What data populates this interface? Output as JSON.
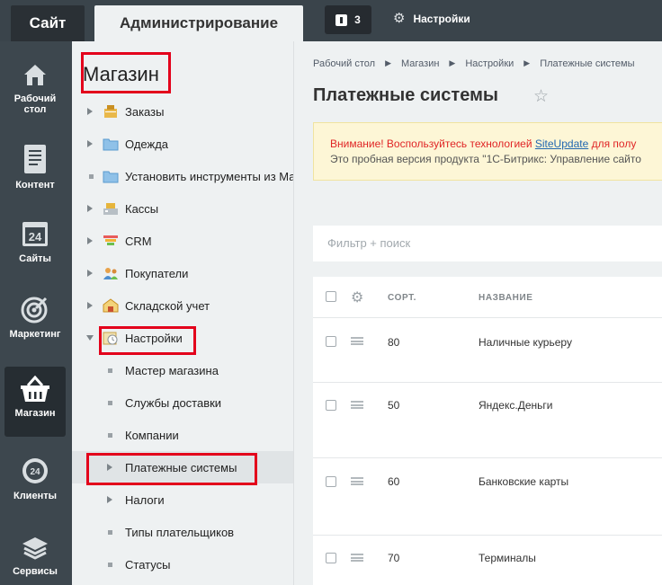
{
  "topbar": {
    "tab_site": "Сайт",
    "tab_admin": "Администрирование",
    "notifications_count": "3",
    "settings_label": "Настройки"
  },
  "rail": [
    {
      "label": "Рабочий стол",
      "icon": "home-icon"
    },
    {
      "label": "Контент",
      "icon": "document-icon"
    },
    {
      "label": "Сайты",
      "icon": "calendar-24-icon"
    },
    {
      "label": "Маркетинг",
      "icon": "target-icon"
    },
    {
      "label": "Магазин",
      "icon": "basket-icon",
      "active": true
    },
    {
      "label": "Клиенты",
      "icon": "clients-24-icon"
    },
    {
      "label": "Сервисы",
      "icon": "layers-icon"
    }
  ],
  "menu": {
    "title": "Магазин",
    "items": [
      {
        "label": "Заказы",
        "marker": "arrow",
        "icon": "orders-icon"
      },
      {
        "label": "Одежда",
        "marker": "arrow",
        "icon": "folder-icon"
      },
      {
        "label": "Установить инструменты из Ма",
        "marker": "dot",
        "icon": "folder-icon"
      },
      {
        "label": "Кассы",
        "marker": "arrow",
        "icon": "cash-register-icon"
      },
      {
        "label": "CRM",
        "marker": "arrow",
        "icon": "crm-funnel-icon"
      },
      {
        "label": "Покупатели",
        "marker": "arrow",
        "icon": "customers-icon"
      },
      {
        "label": "Складской учет",
        "marker": "arrow",
        "icon": "warehouse-icon"
      },
      {
        "label": "Настройки",
        "marker": "arrow-down",
        "icon": "settings-clock-icon"
      }
    ],
    "subitems": [
      {
        "label": "Мастер магазина",
        "marker": "dot"
      },
      {
        "label": "Службы доставки",
        "marker": "dot"
      },
      {
        "label": "Компании",
        "marker": "dot"
      },
      {
        "label": "Платежные системы",
        "marker": "arrow",
        "selected": true
      },
      {
        "label": "Налоги",
        "marker": "arrow"
      },
      {
        "label": "Типы плательщиков",
        "marker": "dot"
      },
      {
        "label": "Статусы",
        "marker": "dot"
      }
    ]
  },
  "main": {
    "breadcrumb": [
      "Рабочий стол",
      "Магазин",
      "Настройки",
      "Платежные системы"
    ],
    "title": "Платежные системы",
    "alert": {
      "line1_prefix": "Внимание! Воспользуйтесь технологией ",
      "line1_link": "SiteUpdate",
      "line1_suffix": " для полу",
      "line2": "Это пробная версия продукта \"1С-Битрикс: Управление сайто"
    },
    "filter_placeholder": "Фильтр + поиск",
    "grid": {
      "col_sort": "СОРТ.",
      "col_name": "НАЗВАНИЕ",
      "rows": [
        {
          "sort": "80",
          "name": "Наличные курьеру"
        },
        {
          "sort": "50",
          "name": "Яндекс.Деньги"
        },
        {
          "sort": "60",
          "name": "Банковские карты"
        },
        {
          "sort": "70",
          "name": "Терминалы"
        }
      ]
    }
  }
}
